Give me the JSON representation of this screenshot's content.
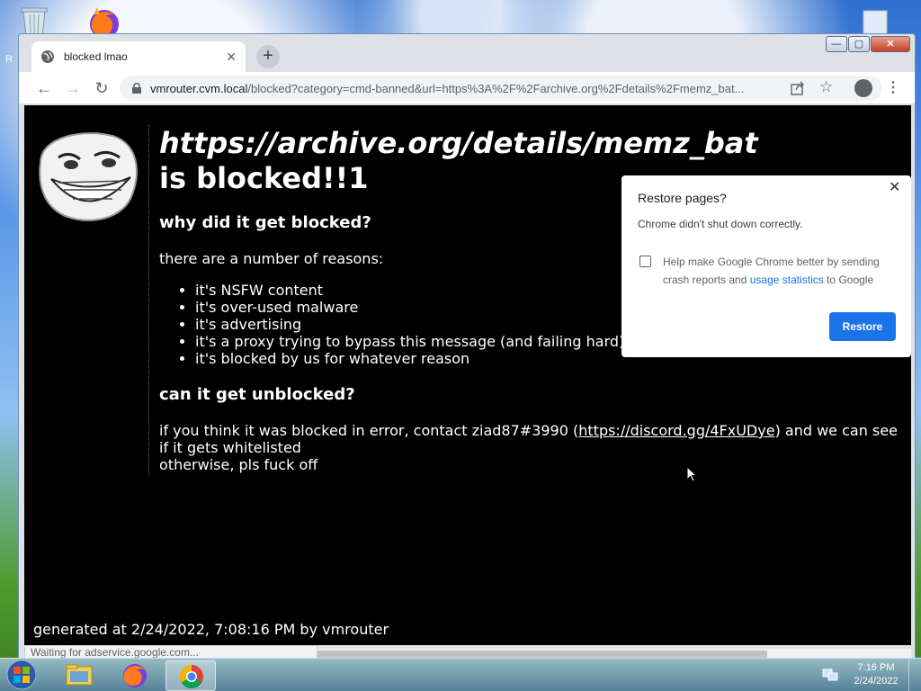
{
  "desktop": {
    "left_label": "R"
  },
  "browser": {
    "tab": {
      "title": "blocked lmao"
    },
    "new_tab_label": "+",
    "window_buttons": {
      "minimize": "—",
      "maximize": "▢",
      "close": "✕"
    },
    "omnibox": {
      "host": "vmrouter.cvm.local",
      "path": "/blocked?category=cmd-banned&url=https%3A%2F%2Farchive.org%2Fdetails%2Fmemz_bat..."
    },
    "status_text": "Waiting for adservice.google.com..."
  },
  "page": {
    "blocked_url": "https://archive.org/details/memz_bat",
    "blocked_suffix": "is blocked!!1",
    "why_heading": "why did it get blocked?",
    "reasons_intro": "there are a number of reasons:",
    "reasons": [
      "it's NSFW content",
      "it's over-used malware",
      "it's advertising",
      "it's a proxy trying to bypass this message (and failing hard)",
      "it's blocked by us for whatever reason"
    ],
    "unblock_heading": "can it get unblocked?",
    "unblock_pre": "if you think it was blocked in error, contact ziad87#3990 (",
    "discord_link": "https://discord.gg/4FxUDye",
    "unblock_post": ") and we can see if it gets whitelisted",
    "unblock_end": "otherwise, pls fuck off",
    "footer": "generated at 2/24/2022, 7:08:16 PM by vmrouter"
  },
  "restore_popup": {
    "title": "Restore pages?",
    "message": "Chrome didn't shut down correctly.",
    "checkbox_pre": "Help make Google Chrome better by sending crash reports and ",
    "checkbox_link": "usage statistics",
    "checkbox_post": " to Google",
    "restore_button": "Restore",
    "close": "✕"
  },
  "taskbar": {
    "clock_time": "7:16 PM",
    "clock_date": "2/24/2022"
  },
  "icons": {
    "desktop": [
      "recycle-bin-icon",
      "firefox-icon",
      "file-icon"
    ],
    "taskbar": [
      "start-orb-icon",
      "explorer-icon",
      "firefox-icon",
      "chrome-icon",
      "network-icon"
    ]
  },
  "colors": {
    "page_bg": "#000000",
    "accent": "#1a73e8",
    "tab_strip": "#dee1e6"
  }
}
